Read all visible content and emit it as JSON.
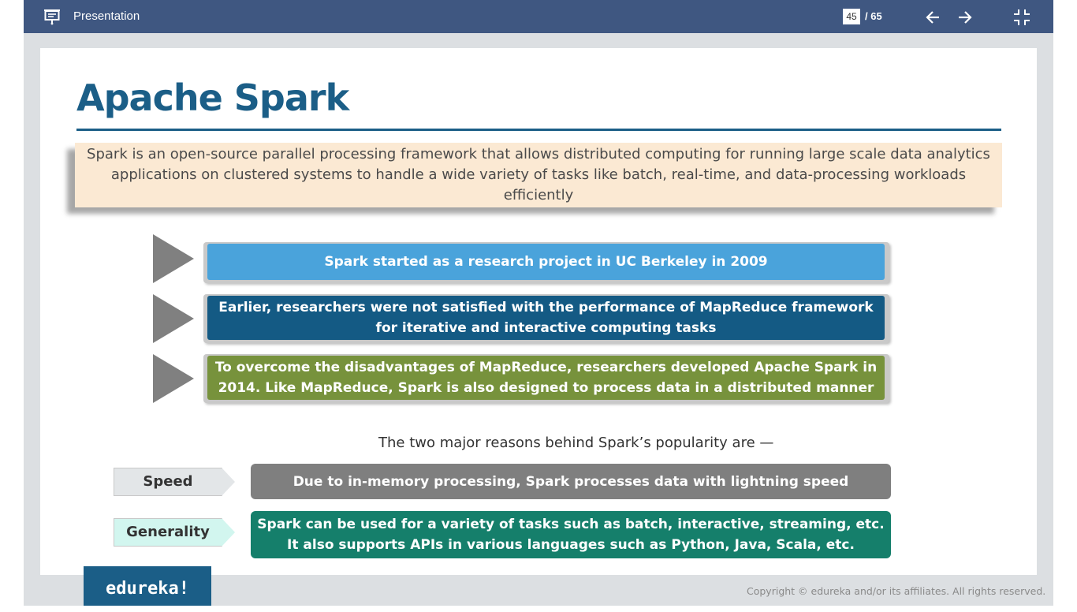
{
  "window": {
    "title": "Presentation",
    "current_page": "45",
    "total_pages": "/ 65"
  },
  "slide": {
    "title": "Apache Spark",
    "intro": "Spark is an open-source parallel processing framework that allows distributed computing for running large scale data analytics applications on clustered systems to handle a wide variety of tasks like batch, real-time, and data-processing workloads efficiently",
    "points": [
      {
        "text": "Spark started as a research project in UC Berkeley in 2009",
        "color": "#4aa3db"
      },
      {
        "text": "Earlier, researchers were not satisfied with the performance of MapReduce framework for iterative and interactive computing tasks",
        "color": "#145a84"
      },
      {
        "text": "To overcome the disadvantages of MapReduce, researchers developed Apache Spark in 2014. Like MapReduce, Spark is also designed to process data in a distributed manner",
        "color": "#77923c"
      }
    ],
    "reasons_label": "The two major reasons behind Spark’s popularity are —",
    "reasons": [
      {
        "tag": "Speed",
        "text": "Due to in-memory processing, Spark processes data with lightning speed",
        "tag_color": "#e3e6e8",
        "color": "#7f7f7f"
      },
      {
        "tag": "Generality",
        "text": "Spark can be used for a variety of tasks such as batch, interactive, streaming, etc. It also supports APIs in various languages such as Python, Java, Scala, etc.",
        "tag_color": "#d2f6ef",
        "color": "#157f6b"
      }
    ]
  },
  "footer": {
    "logo": "edureka!",
    "copyright": "Copyright © edureka and/or its affiliates. All rights reserved."
  },
  "icons": [
    "presentation-icon",
    "arrow-left-icon",
    "arrow-right-icon",
    "exit-fullscreen-icon"
  ]
}
